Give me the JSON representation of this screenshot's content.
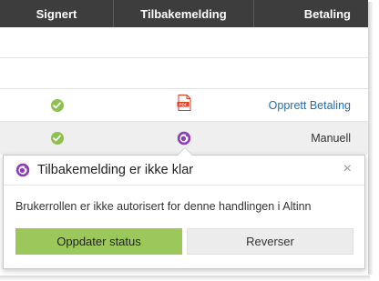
{
  "table": {
    "headers": {
      "signert": "Signert",
      "tilbakemelding": "Tilbakemelding",
      "betaling": "Betaling"
    },
    "rows": [
      {
        "signert": "",
        "tilbakemelding": "",
        "betaling": ""
      },
      {
        "signert": "",
        "tilbakemelding": "",
        "betaling": ""
      },
      {
        "signert_icon": "check-icon",
        "tilbakemelding_icon": "pdf-icon",
        "betaling": "Opprett Betaling"
      },
      {
        "signert_icon": "check-icon",
        "tilbakemelding_icon": "status-pending-icon",
        "betaling": "Manuell"
      }
    ]
  },
  "popover": {
    "title": "Tilbakemelding er ikke klar",
    "message": "Brukerrollen er ikke autorisert for denne handlingen i Altinn",
    "close": "×",
    "primary_button": "Oppdater status",
    "secondary_button": "Reverser"
  },
  "colors": {
    "header_bg": "#3d3d3d",
    "check": "#8cc14c",
    "link": "#1f6fb2",
    "accent_purple": "#8a3db6",
    "primary_button": "#9cc75b",
    "pdf_red": "#d9391f"
  }
}
